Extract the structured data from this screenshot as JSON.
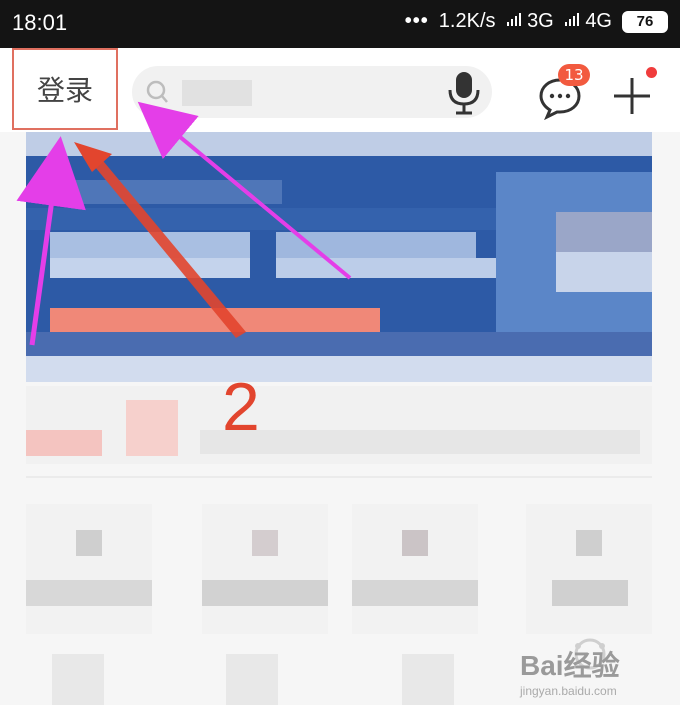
{
  "status_bar": {
    "time": "18:01",
    "dots": "•••",
    "net_speed": "1.2K/s",
    "signal1": "3G",
    "signal2": "4G",
    "battery": "76"
  },
  "app_bar": {
    "login_label": "登录",
    "search_placeholder": "",
    "message_badge": "13"
  },
  "annotation": {
    "step_number": "2"
  },
  "watermark": {
    "brand": "Bai经验",
    "site": "jingyan.baidu.com"
  },
  "colors": {
    "highlight_box": "#e07060",
    "arrow_magenta": "#e43ee8",
    "arrow_red": "#e2452e",
    "badge": "#f25a3f"
  }
}
